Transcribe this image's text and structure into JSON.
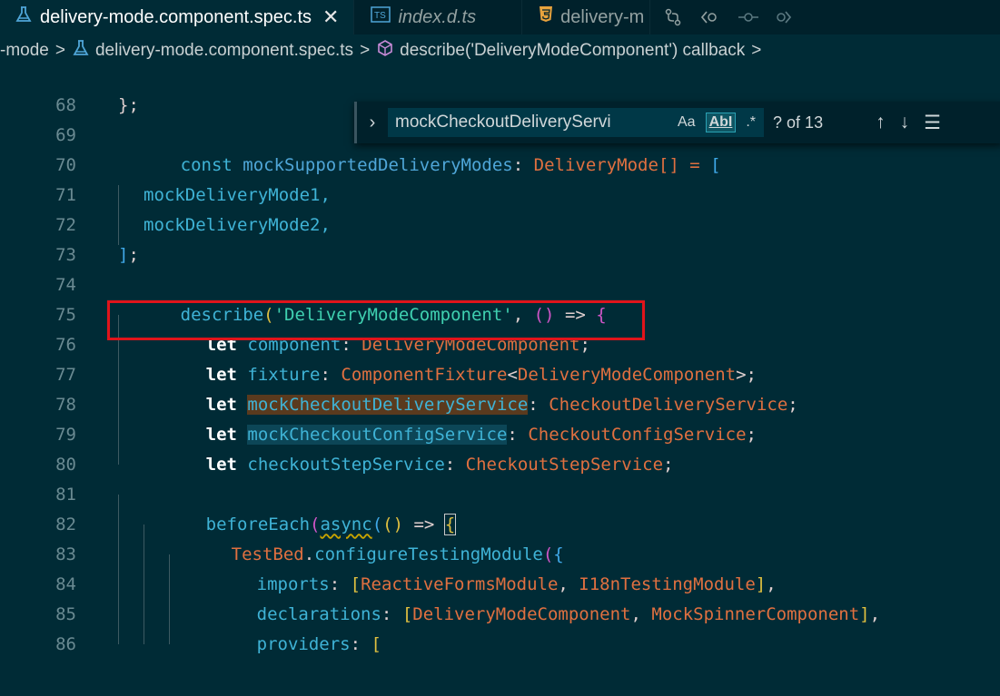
{
  "tabs": [
    {
      "label": "delivery-mode.component.spec.ts",
      "icon": "flask-icon",
      "active": true,
      "close": "✕"
    },
    {
      "label": "index.d.ts",
      "icon": "ts-file-icon",
      "active": false
    },
    {
      "label": "delivery-m",
      "icon": "html5-icon",
      "active": false
    }
  ],
  "breadcrumb": {
    "seg1": "-mode",
    "seg2": "delivery-mode.component.spec.ts",
    "seg3": "describe('DeliveryModeComponent') callback",
    "sep": ">"
  },
  "find": {
    "value": "mockCheckoutDeliveryServi",
    "match_case": "Aa",
    "whole_word": "AbI",
    "regex": ".*",
    "count": "? of 13",
    "up": "↑",
    "down": "↓",
    "menu": "☰"
  },
  "lines": [
    {
      "n": "68"
    },
    {
      "n": "69"
    },
    {
      "n": "70"
    },
    {
      "n": "71"
    },
    {
      "n": "72"
    },
    {
      "n": "73"
    },
    {
      "n": "74"
    },
    {
      "n": "75"
    },
    {
      "n": "76"
    },
    {
      "n": "77"
    },
    {
      "n": "78"
    },
    {
      "n": "79"
    },
    {
      "n": "80"
    },
    {
      "n": "81"
    },
    {
      "n": "82"
    },
    {
      "n": "83"
    },
    {
      "n": "84"
    },
    {
      "n": "85"
    },
    {
      "n": "86"
    }
  ],
  "code": {
    "l68": "};",
    "l70": [
      "const",
      "mockSupportedDeliveryModes",
      ":",
      "DeliveryMode",
      "[]",
      " = ",
      "["
    ],
    "l71": "mockDeliveryMode1,",
    "l72": "mockDeliveryMode2,",
    "l73": [
      "]",
      ";"
    ],
    "l75": [
      "describe",
      "(",
      "'DeliveryModeComponent'",
      ", ",
      "()",
      " => ",
      "{"
    ],
    "l76": [
      "let",
      "component",
      ":",
      "DeliveryModeComponent",
      ";"
    ],
    "l77": [
      "let",
      "fixture",
      ":",
      "ComponentFixture",
      "<",
      "DeliveryModeComponent",
      ">;"
    ],
    "l78": [
      "let",
      "mockCheckoutDeliveryService",
      ":",
      "CheckoutDeliveryService",
      ";"
    ],
    "l79": [
      "let",
      "mockCheckoutConfigService",
      ":",
      "CheckoutConfigService",
      ";"
    ],
    "l80": [
      "let",
      "checkoutStepService",
      ":",
      "CheckoutStepService",
      ";"
    ],
    "l82": [
      "beforeEach",
      "(",
      "async",
      "(",
      "()",
      " => ",
      "{"
    ],
    "l83": [
      "TestBed",
      ".",
      "configureTestingModule",
      "(",
      "{"
    ],
    "l84": [
      "imports",
      ": ",
      "[",
      "ReactiveFormsModule",
      ", ",
      "I18nTestingModule",
      "]",
      ","
    ],
    "l85": [
      "declarations",
      ": ",
      "[",
      "DeliveryModeComponent",
      ", ",
      "MockSpinnerComponent",
      "]",
      ","
    ],
    "l86": [
      "providers",
      ": ",
      "["
    ]
  }
}
